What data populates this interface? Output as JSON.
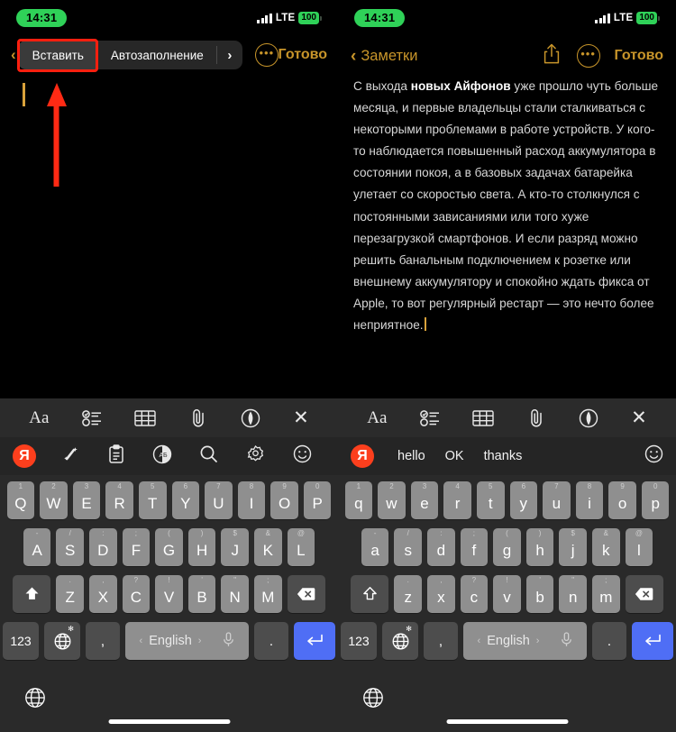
{
  "status": {
    "time": "14:31",
    "carrier": "LTE",
    "battery": "100",
    "signal_icon": "signal-bars-icon",
    "battery_icon": "battery-icon"
  },
  "left_pane": {
    "autofill_bar": {
      "back_chevron": "‹",
      "paste_label": "Вставить",
      "autofill_label": "Автозаполнение",
      "next_chevron": "›",
      "more_icon": "ellipsis-circle-icon",
      "done_label": "Готово"
    },
    "annotation": {
      "highlight_target": "Вставить",
      "highlight_color": "#ff1f0f",
      "arrow_color": "#ff2a14",
      "arrow_direction": "up"
    },
    "note": {
      "text": "",
      "caret_color": "#d9a23b"
    },
    "suggestion_bar": {
      "brand_logo": "Я",
      "brand_color": "#fc3f1d",
      "icons": [
        "magic-wand-icon",
        "clipboard-icon",
        "translate-icon",
        "search-icon",
        "settings-gear-icon",
        "emoji-smiley-icon"
      ]
    }
  },
  "right_pane": {
    "nav": {
      "back_chevron": "‹",
      "back_label": "Заметки",
      "share_icon": "share-icon",
      "more_icon": "ellipsis-circle-icon",
      "done_label": "Готово"
    },
    "note": {
      "paragraph_parts": [
        {
          "text": "С выхода ",
          "bold": false
        },
        {
          "text": "новых Айфонов",
          "bold": true
        },
        {
          "text": " уже прошло чуть больше месяца, и первые владельцы стали сталкиваться с некоторыми проблемами в работе устройств. У кого-то наблюдается повышенный расход аккумулятора в состоянии покоя, а в базовых задачах батарейка улетает со скоростью света. А кто-то столкнулся с постоянными зависаниями или того хуже перезагрузкой смартфонов. И если разряд можно решить банальным подключением к розетке или внешнему аккумулятору и спокойно ждать фикса от Apple, то вот регулярный рестарт — это нечто более неприятное.",
          "bold": false
        }
      ],
      "full_text": "С выхода новых Айфонов уже прошло чуть больше месяца, и первые владельцы стали сталкиваться с некоторыми проблемами в работе устройств. У кого-то наблюдается повышенный расход аккумулятора в состоянии покоя, а в базовых задачах батарейка улетает со скоростью света. А кто-то столкнулся с постоянными зависаниями или того хуже перезагрузкой смартфонов. И если разряд можно решить банальным подключением к розетке или внешнему аккумулятору и спокойно ждать фикса от Apple, то вот регулярный рестарт — это нечто более неприятное.",
      "caret_color": "#d9a23b"
    },
    "suggestion_bar": {
      "brand_logo": "Я",
      "brand_color": "#fc3f1d",
      "words": [
        "hello",
        "OK",
        "thanks"
      ],
      "emoji_icon": "emoji-smiley-icon"
    }
  },
  "format_toolbar": {
    "items": [
      {
        "name": "text-format-icon",
        "label": "Aa"
      },
      {
        "name": "checklist-icon",
        "label": ""
      },
      {
        "name": "table-icon",
        "label": ""
      },
      {
        "name": "attachment-paperclip-icon",
        "label": ""
      },
      {
        "name": "markup-pen-icon",
        "label": ""
      },
      {
        "name": "close-icon",
        "label": "✕"
      }
    ]
  },
  "keyboard": {
    "layout_name": "English",
    "rows": {
      "row1_upper": [
        "Q",
        "W",
        "E",
        "R",
        "T",
        "Y",
        "U",
        "I",
        "O",
        "P"
      ],
      "row1_lower": [
        "q",
        "w",
        "e",
        "r",
        "t",
        "y",
        "u",
        "i",
        "o",
        "p"
      ],
      "row1_secondary": [
        "1",
        "2",
        "3",
        "4",
        "5",
        "6",
        "7",
        "8",
        "9",
        "0"
      ],
      "row2_upper": [
        "A",
        "S",
        "D",
        "F",
        "G",
        "H",
        "J",
        "K",
        "L"
      ],
      "row2_lower": [
        "a",
        "s",
        "d",
        "f",
        "g",
        "h",
        "j",
        "k",
        "l"
      ],
      "row2_secondary": [
        "-",
        "/",
        ":",
        ";",
        "(",
        ")",
        "$",
        "&",
        "@"
      ],
      "row3_upper": [
        "Z",
        "X",
        "C",
        "V",
        "B",
        "N",
        "M"
      ],
      "row3_lower": [
        "z",
        "x",
        "c",
        "v",
        "b",
        "n",
        "m"
      ],
      "row3_secondary": [
        ".",
        ",",
        "?",
        "!",
        "'",
        "\"",
        ";"
      ]
    },
    "shift_icon": "shift-arrow-icon",
    "backspace_icon": "backspace-delete-icon",
    "numbers_label": "123",
    "globe_icon": "globe-language-icon",
    "globe_gear_badge": "gear-icon",
    "comma_label": ",",
    "period_label": ".",
    "space_label": "English",
    "space_prev_arrow": "‹",
    "space_next_arrow": "›",
    "mic_icon": "microphone-icon",
    "return_icon": "return-enter-icon",
    "return_color": "#4f6ef5",
    "bottom_globe_icon": "globe-language-icon",
    "home_indicator": "home-indicator"
  }
}
